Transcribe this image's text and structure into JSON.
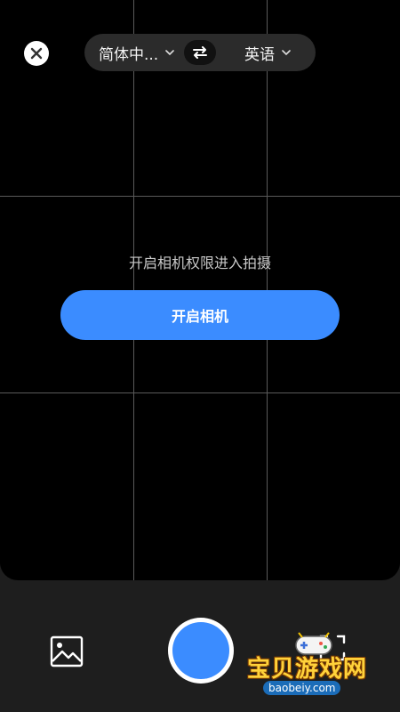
{
  "header": {
    "source_language": "简体中...",
    "target_language": "英语"
  },
  "permission": {
    "hint": "开启相机权限进入拍摄",
    "button_label": "开启相机"
  },
  "watermark": {
    "title": "宝贝游戏网",
    "url": "baobeiy.com"
  },
  "icons": {
    "close": "close-icon",
    "swap": "swap-arrows-icon",
    "chevron": "chevron-down-icon",
    "gallery": "image-icon",
    "scan": "scan-icon"
  },
  "colors": {
    "accent": "#3b8cff",
    "viewfinder_bg": "#000000",
    "bottom_bar_bg": "#1e1e1e"
  }
}
